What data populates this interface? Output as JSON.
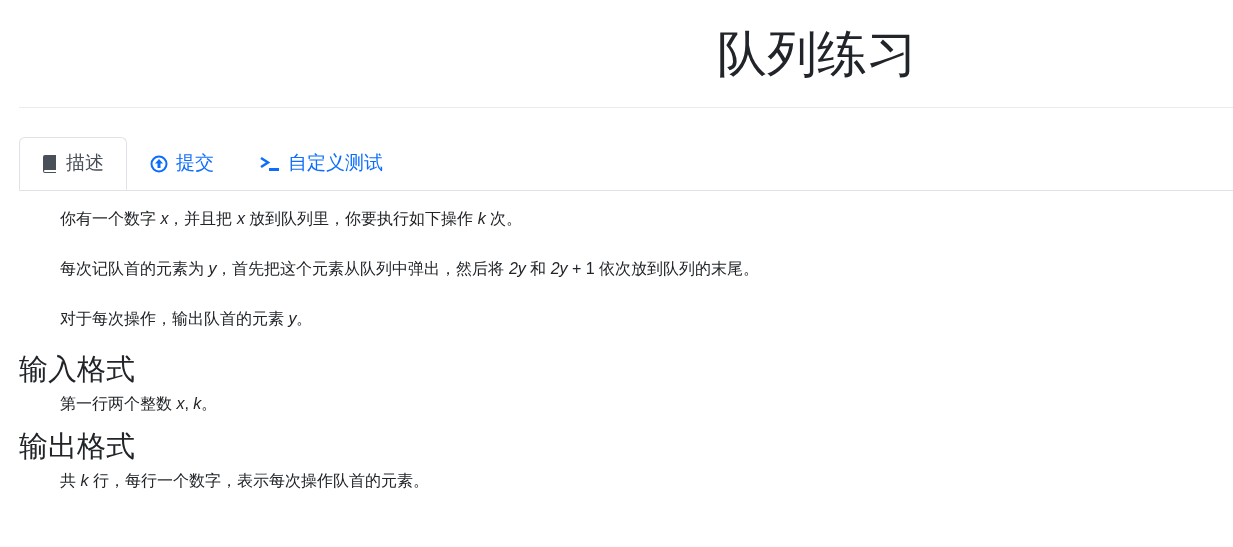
{
  "title": "队列练习",
  "tabs": [
    {
      "label": "描述",
      "kind": "book",
      "selected": true
    },
    {
      "label": "提交",
      "kind": "upload",
      "selected": false
    },
    {
      "label": "自定义测试",
      "kind": "terminal",
      "selected": false
    }
  ],
  "description": [
    "你有一个数字 *x*，并且把 *x* 放到队列里，你要执行如下操作 *k* 次。",
    "每次记队首的元素为 *y*，首先把这个元素从队列中弹出，然后将 *2y* 和 *2y* + 1 依次放到队列的末尾。",
    "对于每次操作，输出队首的元素 *y*。"
  ],
  "sections": [
    {
      "heading": "输入格式",
      "text": "第一行两个整数 *x*, *k*。"
    },
    {
      "heading": "输出格式",
      "text": "共 *k* 行，每行一个数字，表示每次操作队首的元素。"
    }
  ]
}
